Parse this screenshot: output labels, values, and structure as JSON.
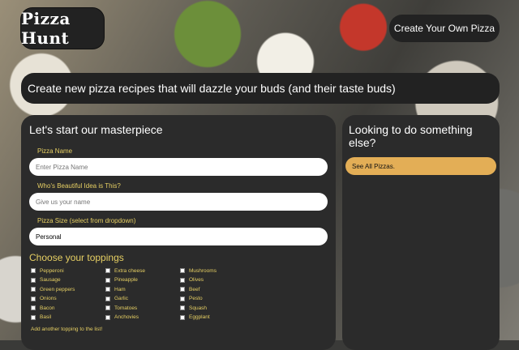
{
  "header": {
    "logo_text": "Pizza Hunt",
    "create_button": "Create Your Own Pizza"
  },
  "hero": {
    "text": "Create new pizza recipes that will dazzle your buds (and their taste buds)"
  },
  "form": {
    "title": "Let's start our masterpiece",
    "pizza_name_label": "Pizza Name",
    "pizza_name_placeholder": "Enter Pizza Name",
    "creator_label": "Who's Beautiful Idea is This?",
    "creator_placeholder": "Give us your name",
    "size_label": "Pizza Size (select from dropdown)",
    "size_value": "Personal",
    "toppings_title": "Choose your toppings",
    "toppings": [
      "Pepperoni",
      "Extra cheese",
      "Mushrooms",
      "Sausage",
      "Pineapple",
      "Olives",
      "Green peppers",
      "Ham",
      "Beef",
      "Onions",
      "Garlic",
      "Pesto",
      "Bacon",
      "Tomatoes",
      "Squash",
      "Basil",
      "Anchovies",
      "Eggplant"
    ],
    "add_topping": "Add another topping to the list!"
  },
  "sidebar": {
    "title": "Looking to do something else?",
    "see_all": "See All Pizzas."
  },
  "colors": {
    "panel": "#2b2b2b",
    "accent_text": "#e6cf63",
    "button_accent": "#e3ae56"
  }
}
